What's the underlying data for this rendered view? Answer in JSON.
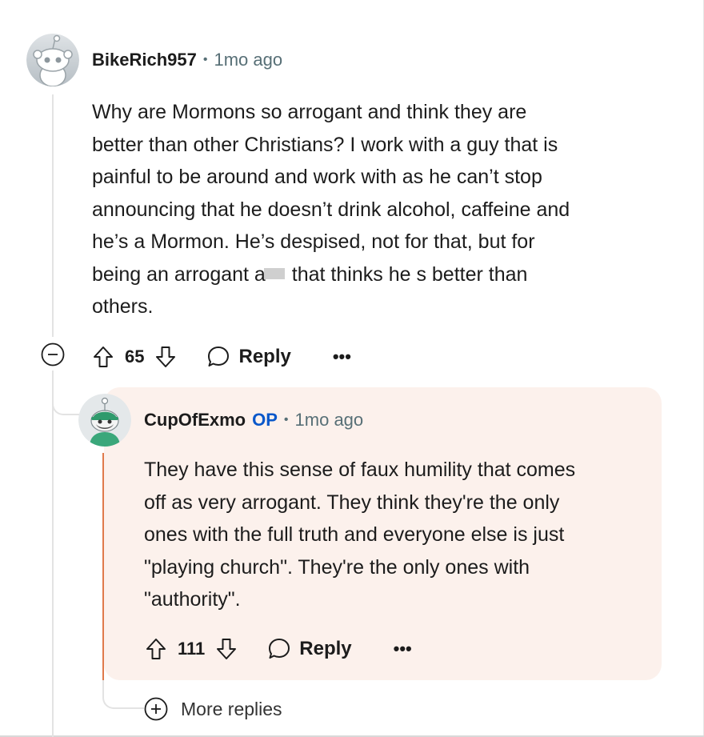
{
  "comments": [
    {
      "username": "BikeRich957",
      "time": "1mo ago",
      "body_lines": [
        "Why are Mormons so arrogant and think they are",
        "better than other Christians? I work with a guy that is",
        "painful to be around and work with as he can’t stop",
        "announcing that he doesn’t drink alcohol, caffeine and",
        "he’s a Mormon. He’s despised, not for that, but for"
      ],
      "body_redacted_before": "being an arrogant a",
      "body_redacted_after": " that thinks he s better than",
      "body_last_line": "others.",
      "votes": "65",
      "reply_label": "Reply",
      "more_label": "•••"
    },
    {
      "username": "CupOfExmo",
      "op_badge": "OP",
      "time": "1mo ago",
      "body_lines": [
        "They have this sense of faux humility that comes",
        "off as very arrogant. They think they're the only",
        "ones with the full truth and everyone else is just",
        "\"playing church\". They're the only ones with",
        "\"authority\"."
      ],
      "votes": "111",
      "reply_label": "Reply",
      "more_label": "•••"
    }
  ],
  "separator": "•",
  "more_replies_label": "More replies",
  "icons": {
    "collapse": "minus-circle-icon",
    "upvote": "arrow-up-icon",
    "downvote": "arrow-down-icon",
    "reply": "speech-bubble-icon",
    "expand": "plus-circle-icon"
  },
  "colors": {
    "op_badge": "#0a58ca",
    "reply_background": "#fcf1ec",
    "reply_thread_line": "#e07a4b",
    "meta_text": "#576f76"
  }
}
